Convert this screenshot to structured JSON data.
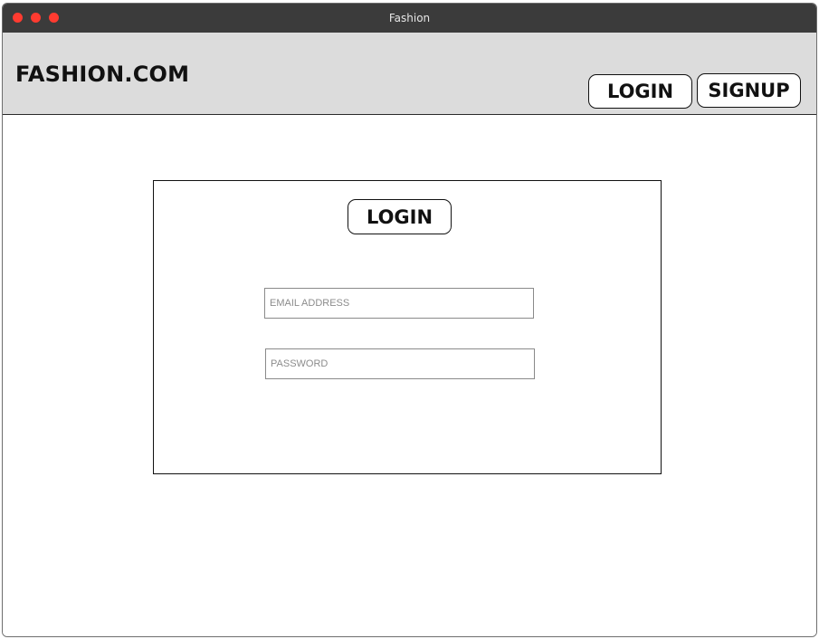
{
  "window": {
    "title": "Fashion"
  },
  "header": {
    "brand": "FASHION.COM",
    "login_label": "LOGIN",
    "signup_label": "SIGNUP"
  },
  "login_card": {
    "title": "LOGIN",
    "email_placeholder": "EMAIL ADDRESS",
    "password_placeholder": "PASSWORD"
  },
  "colors": {
    "titlebar": "#3b3b3b",
    "header_bg": "#dcdcdc",
    "traffic_light": "#ff3b30"
  }
}
